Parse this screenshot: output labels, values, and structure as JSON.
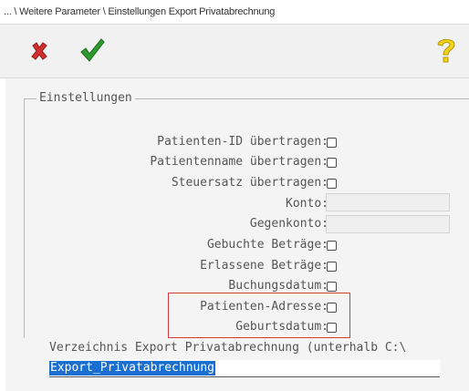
{
  "window": {
    "title": "... \\ Weitere Parameter \\ Einstellungen Export Privatabrechnung"
  },
  "toolbar": {
    "cancel_icon": "red-x-icon",
    "ok_icon": "green-check-icon",
    "help_icon": "yellow-question-icon",
    "colors": {
      "cancel": "#d42f2f",
      "ok": "#2e9b2e",
      "help": "#f2d31a"
    }
  },
  "settings": {
    "group_label": "Einstellungen",
    "fields": {
      "patient_id": {
        "label": "Patienten-ID übertragen:",
        "checked": false
      },
      "patient_name": {
        "label": "Patientenname übertragen:",
        "checked": false
      },
      "tax_rate": {
        "label": "Steuersatz übertragen:",
        "checked": false
      },
      "account": {
        "label": "Konto:",
        "value": ""
      },
      "contra_account": {
        "label": "Gegenkonto:",
        "value": ""
      },
      "booked_amounts": {
        "label": "Gebuchte Beträge:",
        "checked": false
      },
      "waived_amounts": {
        "label": "Erlassene Beträge:",
        "checked": false
      },
      "booking_date": {
        "label": "Buchungsdatum:",
        "checked": false
      },
      "patient_address": {
        "label": "Patienten-Adresse:",
        "checked": false
      },
      "birth_date": {
        "label": "Geburtsdatum:",
        "checked": false
      }
    },
    "highlight_color": "#d53939"
  },
  "export_dir": {
    "label": "Verzeichnis Export Privatabrechnung (unterhalb C:\\",
    "value": "Export_Privatabrechnung"
  }
}
